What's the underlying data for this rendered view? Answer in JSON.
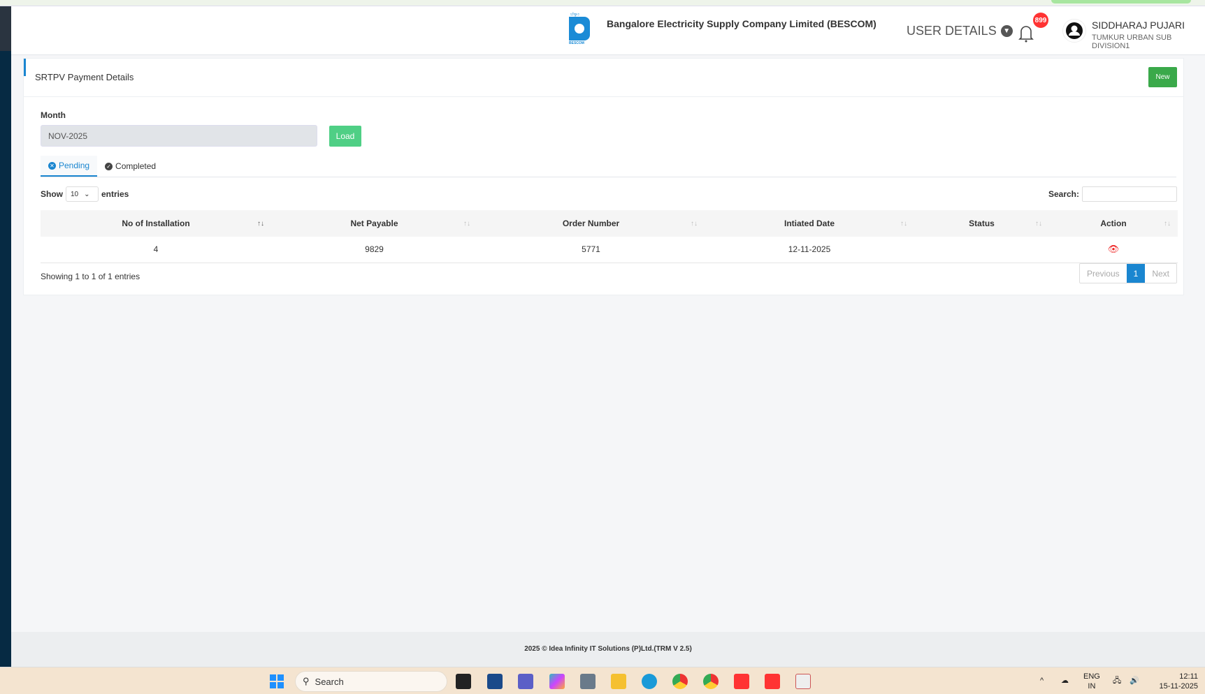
{
  "header": {
    "company": "Bangalore Electricity Supply Company Limited (BESCOM)",
    "user_details": "USER DETAILS",
    "notifications": "899",
    "user_name": "SIDDHARAJ PUJARI",
    "user_division": "TUMKUR URBAN SUB DIVISION1",
    "logo_text": "BESCOM"
  },
  "card": {
    "title": "SRTPV Payment Details",
    "new_label": "New",
    "month_label": "Month",
    "month_value": "NOV-2025",
    "load_label": "Load",
    "tabs": [
      {
        "label": "Pending"
      },
      {
        "label": "Completed"
      }
    ],
    "show": "Show",
    "page_size": "10",
    "entries": "entries",
    "search_label": "Search:",
    "columns": [
      "No of Installation",
      "Net Payable",
      "Order Number",
      "Intiated Date",
      "Status",
      "Action"
    ],
    "rows": [
      {
        "installations": "4",
        "net_payable": "9829",
        "order_number": "5771",
        "initiated_date": "12-11-2025",
        "status": ""
      }
    ],
    "info": "Showing 1 to 1 of 1 entries",
    "pagination": {
      "previous": "Previous",
      "current": "1",
      "next": "Next"
    }
  },
  "footer": "2025 © Idea Infinity IT Solutions (P)Ltd.(TRM V 2.5)",
  "taskbar": {
    "search": "Search",
    "lang": "ENG",
    "region": "IN",
    "time": "12:11",
    "date": "15-11-2025"
  }
}
